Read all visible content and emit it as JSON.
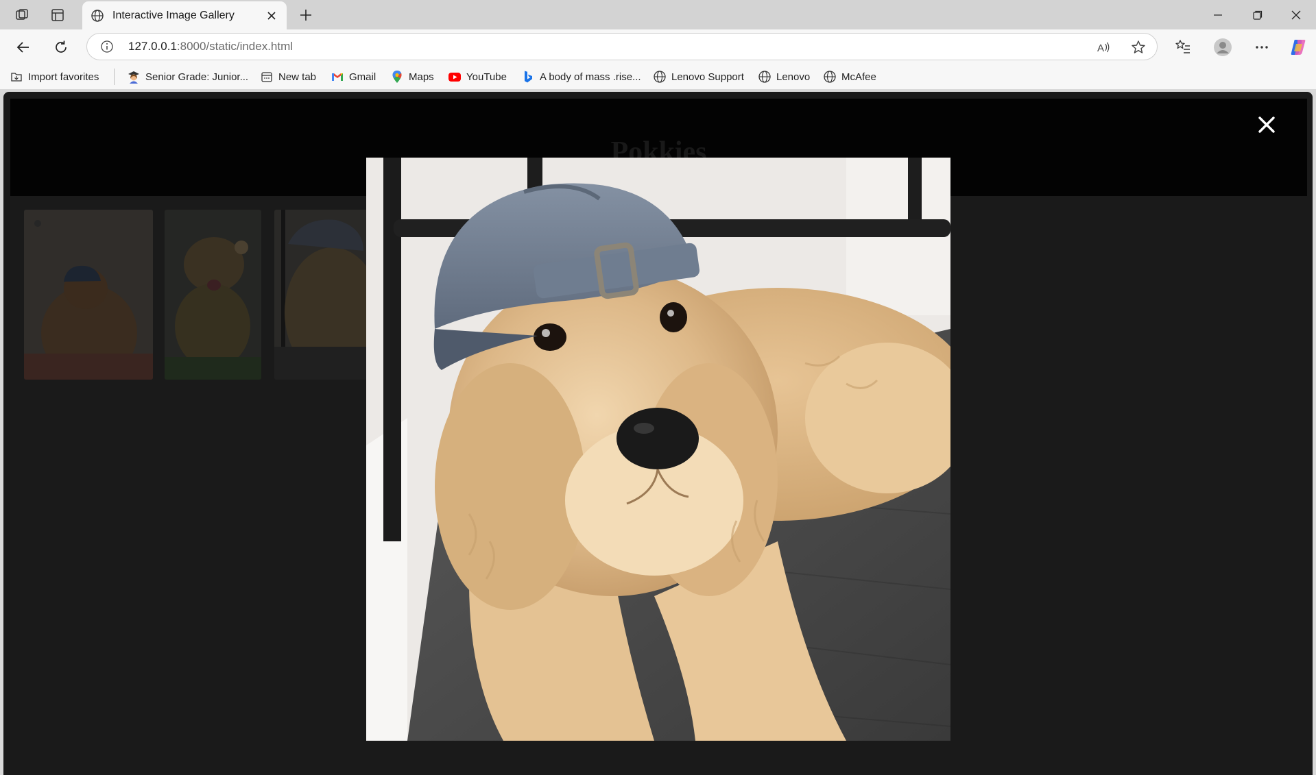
{
  "browser": {
    "tab_title": "Interactive Image Gallery",
    "url_host": "127.0.0.1",
    "url_rest": ":8000/static/index.html"
  },
  "bookmarks": [
    {
      "label": "Import favorites",
      "icon": "import-favorites-icon"
    },
    {
      "label": "Senior Grade: Junior...",
      "icon": "student-emoji-icon"
    },
    {
      "label": "New tab",
      "icon": "new-tab-icon"
    },
    {
      "label": "Gmail",
      "icon": "gmail-icon"
    },
    {
      "label": "Maps",
      "icon": "maps-pin-icon"
    },
    {
      "label": "YouTube",
      "icon": "youtube-icon"
    },
    {
      "label": "A body of mass .rise...",
      "icon": "bing-icon"
    },
    {
      "label": "Lenovo Support",
      "icon": "globe-icon"
    },
    {
      "label": "Lenovo",
      "icon": "globe-icon"
    },
    {
      "label": "McAfee",
      "icon": "globe-icon"
    }
  ],
  "page": {
    "title": "Pokkies"
  },
  "gallery": {
    "thumbnails": [
      "dog-in-cap-thumbnail",
      "dog-with-flower-thumbnail",
      "dog-in-cap-closeup-thumbnail"
    ]
  },
  "lightbox": {
    "image": "golden-retriever-wearing-backwards-cap",
    "close_icon": "close-icon"
  },
  "colors": {
    "page_background": "#1a1a1a",
    "header_background": "#030303",
    "chrome_background": "#f7f7f7",
    "tabstrip_background": "#d3d3d3"
  }
}
